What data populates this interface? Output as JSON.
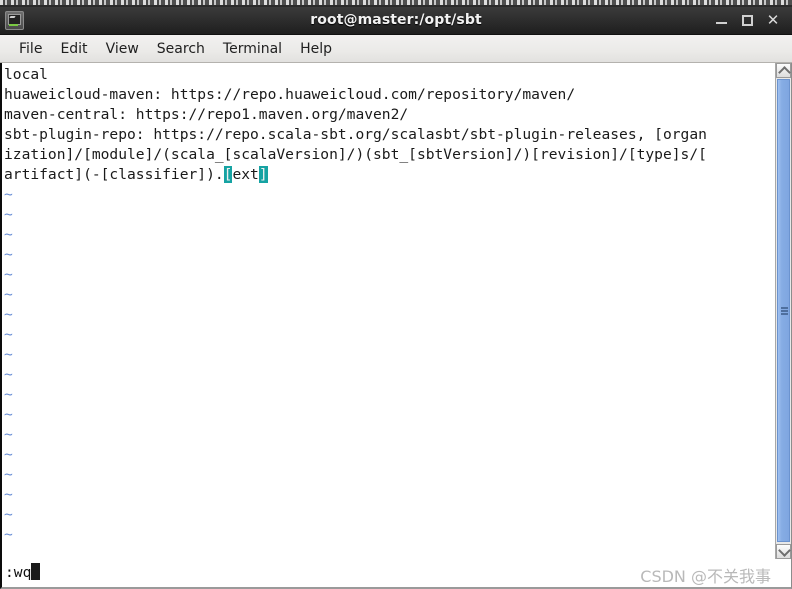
{
  "window": {
    "title": "root@master:/opt/sbt",
    "app_icon": "terminal-icon",
    "controls": {
      "minimize": "_",
      "maximize": "□",
      "close": "✕"
    }
  },
  "menubar": {
    "items": [
      {
        "label": "File"
      },
      {
        "label": "Edit"
      },
      {
        "label": "View"
      },
      {
        "label": "Search"
      },
      {
        "label": "Terminal"
      },
      {
        "label": "Help"
      }
    ]
  },
  "terminal": {
    "lines": [
      {
        "text": "local"
      },
      {
        "text": "huaweicloud-maven: https://repo.huaweicloud.com/repository/maven/"
      },
      {
        "text": "maven-central: https://repo1.maven.org/maven2/"
      },
      {
        "text": "sbt-plugin-repo: https://repo.scala-sbt.org/scalasbt/sbt-plugin-releases, [organ"
      },
      {
        "text": "ization]/[module]/(scala_[scalaVersion]/)(sbt_[sbtVersion]/)[revision]/[type]s/["
      }
    ],
    "last_line": {
      "prefix": "artifact](-[classifier]).",
      "bracket_open": "[",
      "highlight_text": "ext",
      "bracket_close": "]"
    },
    "empty_marker": "~",
    "empty_marker_count": 18,
    "colors": {
      "background": "#ffffff",
      "foreground": "#1a1a1a",
      "tilde": "#6a8fd6",
      "highlight_bg": "#16a3a3",
      "highlight_fg": "#f0f0f0"
    }
  },
  "scrollbar": {
    "up_arrow": "scroll-up-arrow",
    "down_arrow": "scroll-down-arrow",
    "thumb": "scroll-thumb"
  },
  "statusbar": {
    "command": ":wq",
    "cursor": "block-cursor"
  },
  "watermark": {
    "text": "CSDN @不关我事"
  }
}
